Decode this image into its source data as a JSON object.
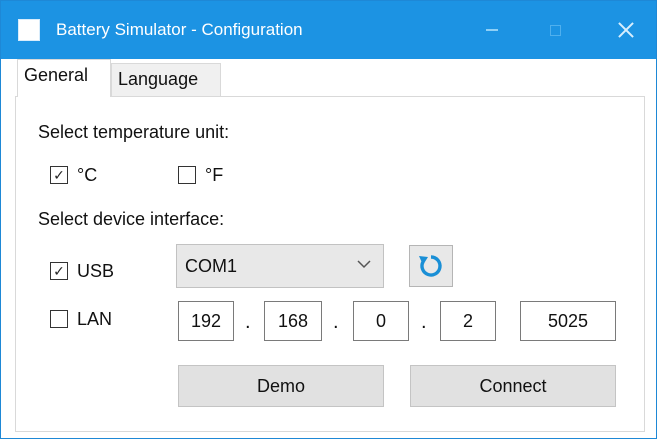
{
  "window": {
    "title": "Battery Simulator - Configuration",
    "controls": {
      "minimize_icon": "minimize-icon",
      "maximize_icon": "maximize-icon",
      "close_icon": "close-icon"
    }
  },
  "tabs": [
    {
      "label": "General",
      "active": true
    },
    {
      "label": "Language",
      "active": false
    }
  ],
  "temperature": {
    "label": "Select temperature unit:",
    "celsius": {
      "label": "°C",
      "checked": true
    },
    "fahrenheit": {
      "label": "°F",
      "checked": false
    }
  },
  "interface": {
    "label": "Select device interface:",
    "usb": {
      "label": "USB",
      "checked": true,
      "port": "COM1"
    },
    "lan": {
      "label": "LAN",
      "checked": false,
      "ip": [
        "192",
        "168",
        "0",
        "2"
      ],
      "separator": ".",
      "port": "5025"
    }
  },
  "buttons": {
    "demo": "Demo",
    "connect": "Connect"
  },
  "colors": {
    "titlebar": "#1c93e3",
    "refresh_icon": "#1a8fd6"
  }
}
